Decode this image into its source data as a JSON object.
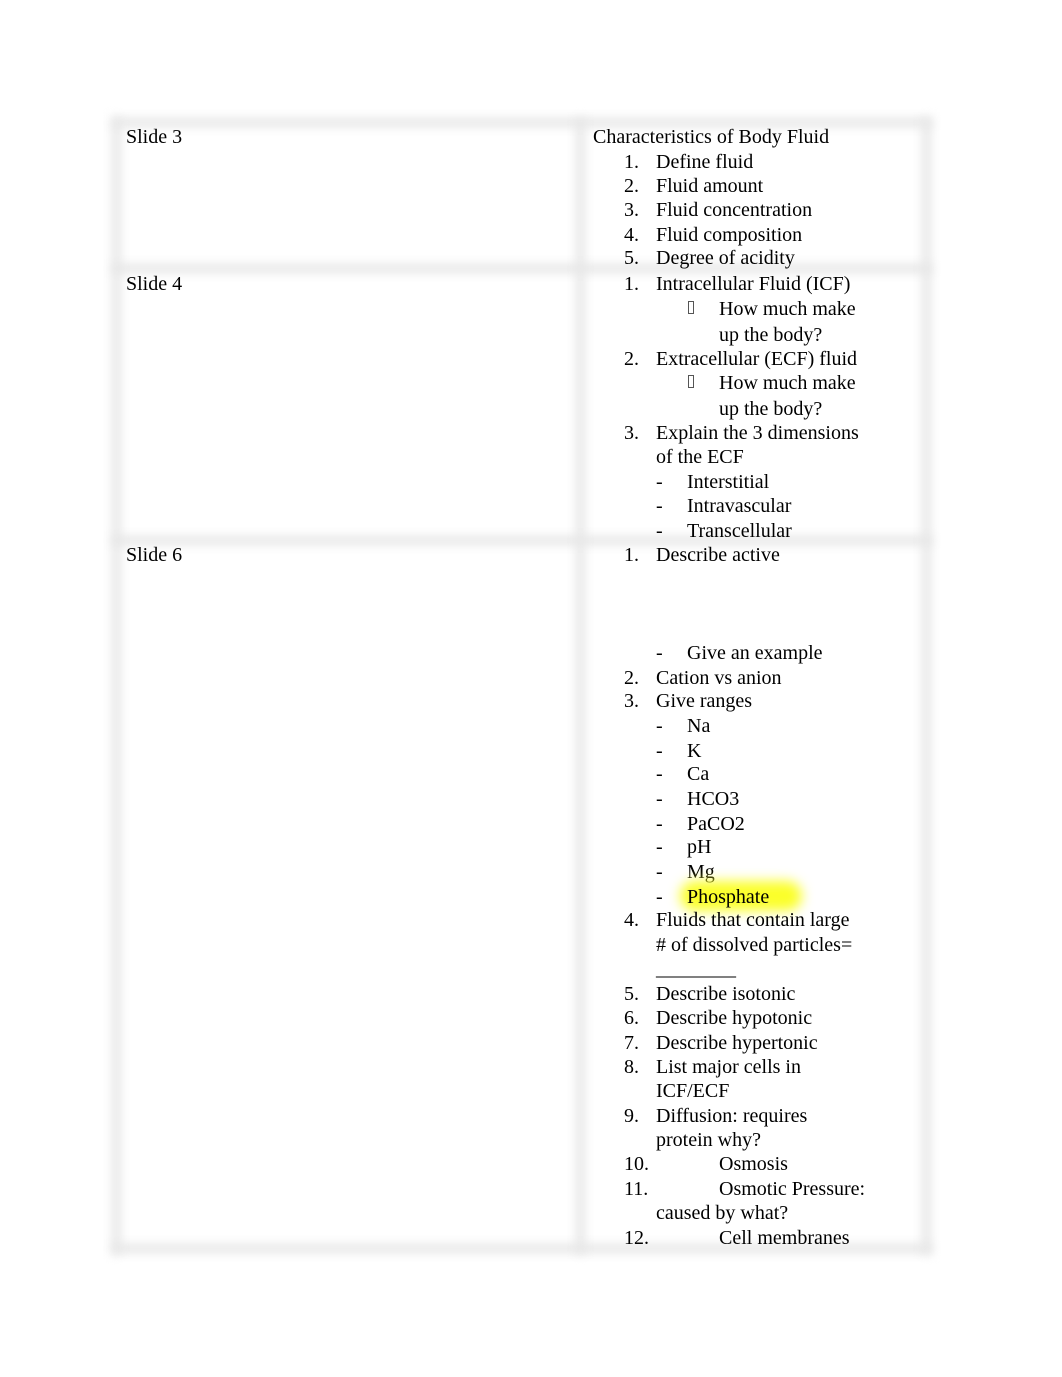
{
  "document": {
    "rows": [
      {
        "slide_label": "Slide 3",
        "heading": "Characteristics of Body Fluid",
        "items": [
          {
            "num": "1.",
            "text": "Define fluid"
          },
          {
            "num": "2.",
            "text": "Fluid amount"
          },
          {
            "num": "3.",
            "text": "Fluid concentration"
          },
          {
            "num": "4.",
            "text": "Fluid composition"
          },
          {
            "num": "5.",
            "text": "Degree of acidity"
          }
        ]
      },
      {
        "slide_label": "Slide 4",
        "items": [
          {
            "num": "1.",
            "text": "Intracellular Fluid (ICF)",
            "sub_bullets": [
              {
                "icon": "missing-glyph-bullet-icon",
                "lines": [
                  "How much make",
                  "up the body?"
                ]
              }
            ]
          },
          {
            "num": "2.",
            "text": "Extracellular (ECF) fluid",
            "sub_bullets": [
              {
                "icon": "missing-glyph-bullet-icon",
                "lines": [
                  "How much make",
                  "up the body?"
                ]
              }
            ]
          },
          {
            "num": "3.",
            "lines": [
              "Explain the 3 dimensions",
              "of the ECF"
            ],
            "sub_dashes": [
              "Interstitial",
              "Intravascular",
              "Transcellular"
            ]
          }
        ]
      },
      {
        "slide_label": "Slide 6",
        "items": [
          {
            "num": "1.",
            "text": "Describe active",
            "sub_dashes": [
              "Give an example"
            ]
          },
          {
            "num": "2.",
            "text": "Cation vs anion"
          },
          {
            "num": "3.",
            "text": "Give ranges",
            "sub_dashes": [
              "Na",
              "K",
              "Ca",
              "HCO3",
              "PaCO2",
              "pH",
              "Mg",
              "Phosphate"
            ],
            "highlighted": "Phosphate"
          },
          {
            "num": "4.",
            "lines": [
              "Fluids that contain large",
              "# of dissolved particles=",
              "________"
            ]
          },
          {
            "num": "5.",
            "text": "Describe isotonic"
          },
          {
            "num": "6.",
            "text": "Describe hypotonic"
          },
          {
            "num": "7.",
            "text": "Describe hypertonic"
          },
          {
            "num": "8.",
            "lines": [
              "List major cells in",
              "ICF/ECF"
            ]
          },
          {
            "num": "9.",
            "lines": [
              "Diffusion: requires",
              "protein why?"
            ]
          },
          {
            "num": "10.",
            "text": "Osmosis"
          },
          {
            "num": "11.",
            "lines": [
              "Osmotic Pressure:",
              "caused by what?"
            ]
          },
          {
            "num": "12.",
            "text": "Cell membranes"
          }
        ]
      }
    ],
    "highlight_color": "#fbff2a"
  }
}
